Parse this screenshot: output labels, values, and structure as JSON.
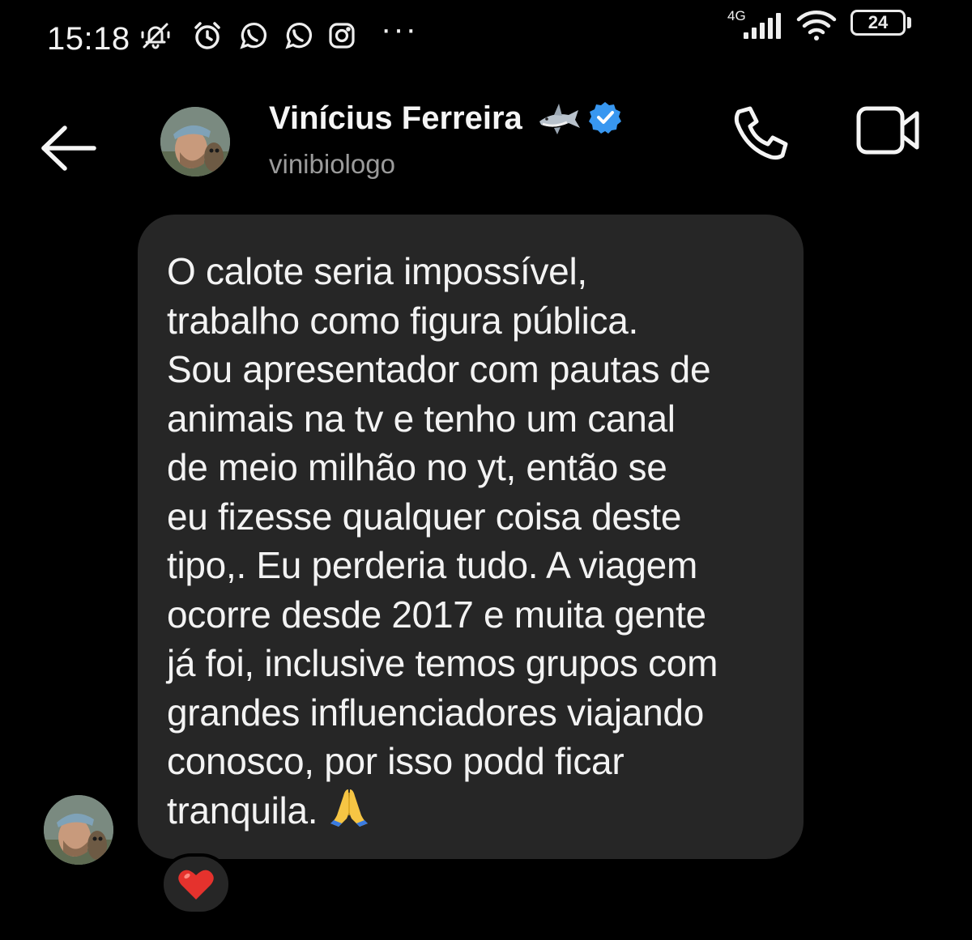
{
  "status_bar": {
    "time": "15:18",
    "network": "4G",
    "battery_level": "24",
    "more": "···",
    "icons": [
      "mute-bell-icon",
      "alarm-icon",
      "whatsapp-icon",
      "whatsapp-icon",
      "instagram-icon",
      "signal-icon",
      "wifi-icon",
      "battery-icon"
    ]
  },
  "header": {
    "back_icon": "arrow-left-icon",
    "contact_name": "Vinícius Ferreira",
    "name_emoji": "shark-icon",
    "verified_icon": "verified-badge-icon",
    "username": "vinibiologo",
    "actions": [
      "phone-icon",
      "video-camera-icon"
    ]
  },
  "message": {
    "text": "O calote seria impossível,\ntrabalho como figura pública.\nSou apresentador com pautas de\nanimais na tv e tenho um canal\nde meio milhão no yt, então se\neu fizesse qualquer coisa deste\ntipo,. Eu perderia tudo. A viagem\nocorre desde 2017 e muita gente\njá foi, inclusive temos grupos com\ngrandes influenciadores viajando\nconosco, por isso podd ficar\ntranquila.",
    "trailing_emoji": "folded-hands-icon",
    "reaction": "red-heart-icon"
  },
  "colors": {
    "background": "#000000",
    "bubble": "#262626",
    "text": "#f3f3f3",
    "username": "#9b9b9b",
    "verified": "#3897f0",
    "heart": "#e5322d"
  }
}
